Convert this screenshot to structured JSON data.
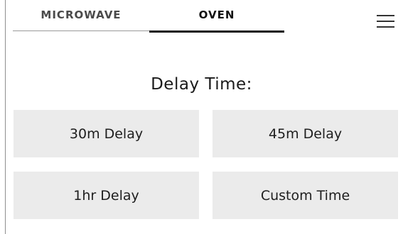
{
  "tabs": [
    {
      "label": "MICROWAVE",
      "active": false
    },
    {
      "label": "OVEN",
      "active": true
    }
  ],
  "menu": {
    "icon": "hamburger-menu-icon"
  },
  "main": {
    "title": "Delay Time:",
    "options": [
      {
        "label": "30m Delay"
      },
      {
        "label": "45m Delay"
      },
      {
        "label": "1hr Delay"
      },
      {
        "label": "Custom Time"
      }
    ]
  }
}
